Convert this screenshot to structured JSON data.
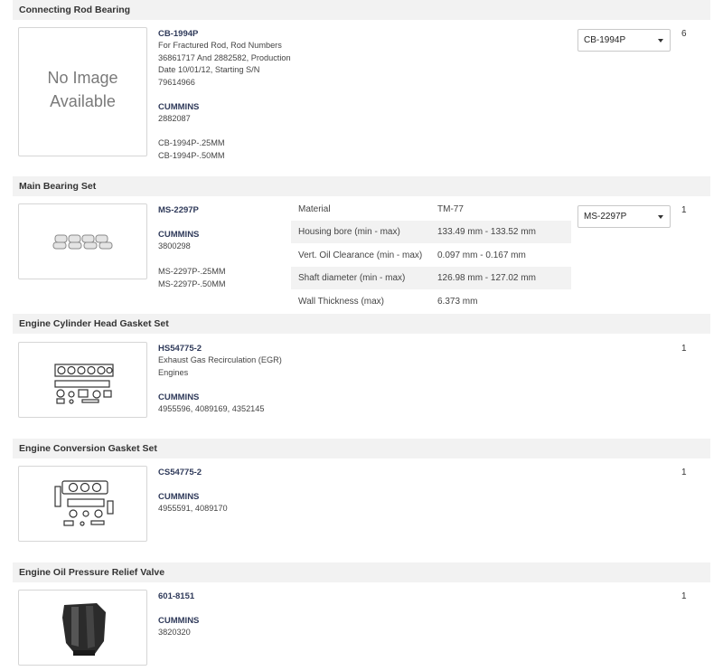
{
  "sections": [
    {
      "title": "Connecting Rod Bearing",
      "image_text": [
        "No Image",
        "Available"
      ],
      "part_number": "CB-1994P",
      "description": [
        "For Fractured Rod, Rod Numbers",
        "36861717 And 2882582, Production",
        "Date 10/01/12, Starting S/N",
        "79614966"
      ],
      "brand": "CUMMINS",
      "oem": "2882087",
      "alternates": [
        "CB-1994P-.25MM",
        "CB-1994P-.50MM"
      ],
      "select_value": "CB-1994P",
      "qty": "6"
    },
    {
      "title": "Main Bearing Set",
      "part_number": "MS-2297P",
      "brand": "CUMMINS",
      "oem": "3800298",
      "alternates": [
        "MS-2297P-.25MM",
        "MS-2297P-.50MM"
      ],
      "specs": [
        {
          "key": "Material",
          "value": "TM-77"
        },
        {
          "key": "Housing bore (min - max)",
          "value": "133.49 mm - 133.52 mm"
        },
        {
          "key": "Vert. Oil Clearance (min - max)",
          "value": "0.097 mm - 0.167 mm"
        },
        {
          "key": "Shaft diameter (min - max)",
          "value": "126.98 mm - 127.02 mm"
        },
        {
          "key": "Wall Thickness (max)",
          "value": "6.373 mm"
        }
      ],
      "select_value": "MS-2297P",
      "qty": "1"
    },
    {
      "title": "Engine Cylinder Head Gasket Set",
      "part_number": "HS54775-2",
      "description": [
        "Exhaust Gas Recirculation (EGR)",
        "Engines"
      ],
      "brand": "CUMMINS",
      "oem": "4955596, 4089169, 4352145",
      "qty": "1"
    },
    {
      "title": "Engine Conversion Gasket Set",
      "part_number": "CS54775-2",
      "brand": "CUMMINS",
      "oem": "4955591, 4089170",
      "qty": "1"
    },
    {
      "title": "Engine Oil Pressure Relief Valve",
      "part_number": "601-8151",
      "brand": "CUMMINS",
      "oem": "3820320",
      "qty": "1"
    }
  ]
}
